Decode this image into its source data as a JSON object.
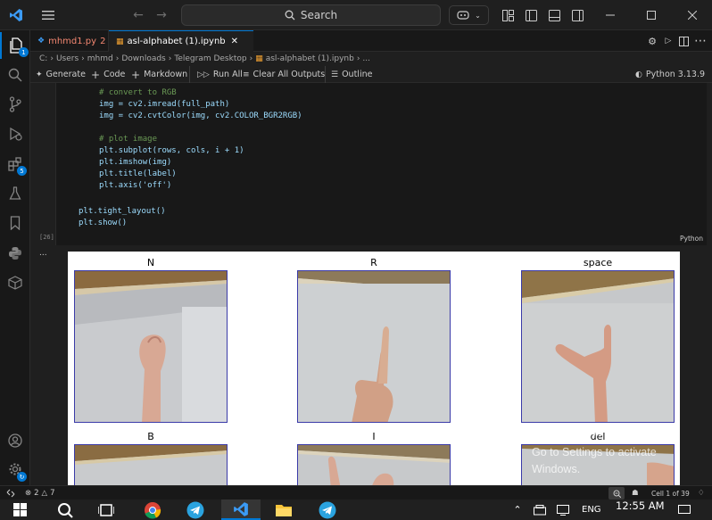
{
  "titlebar": {
    "search_label": "Search"
  },
  "tabs": [
    {
      "label": "mhmd1.py",
      "count": "2"
    },
    {
      "label": "asl-alphabet (1).ipynb"
    }
  ],
  "breadcrumb": {
    "items": [
      "C:",
      "Users",
      "mhmd",
      "Downloads",
      "Telegram Desktop",
      "asl-alphabet (1).ipynb",
      "..."
    ]
  },
  "notebook_toolbar": {
    "generate": "Generate",
    "code": "Code",
    "markdown": "Markdown",
    "run_all": "Run All",
    "clear_outputs": "Clear All Outputs",
    "outline": "Outline",
    "kernel": "Python 3.13.9"
  },
  "code_cell": {
    "lines": [
      "# convert to RGB",
      "img = cv2.imread(full_path)",
      "img = cv2.cvtColor(img, cv2.COLOR_BGR2RGB)",
      "",
      "# plot image",
      "plt.subplot(rows, cols, i + 1)",
      "plt.imshow(img)",
      "plt.title(label)",
      "plt.axis('off')",
      "",
      "plt.tight_layout()",
      "plt.show()"
    ],
    "exec_count": "[26]",
    "language": "Python"
  },
  "output": {
    "more": "...",
    "titles": [
      "N",
      "R",
      "space",
      "B",
      "I",
      "del"
    ]
  },
  "watermark": {
    "line1": "Activate Windows",
    "line2": "Go to Settings to activate Windows."
  },
  "statusbar": {
    "errors": "2",
    "warnings": "7",
    "cell_position": "Cell 1 of 39"
  },
  "taskbar": {
    "language": "ENG",
    "time": "12:55 AM"
  },
  "colors": {
    "accent": "#0078d4",
    "tab_modified": "#f48771",
    "frame": "#3a3aa8"
  }
}
